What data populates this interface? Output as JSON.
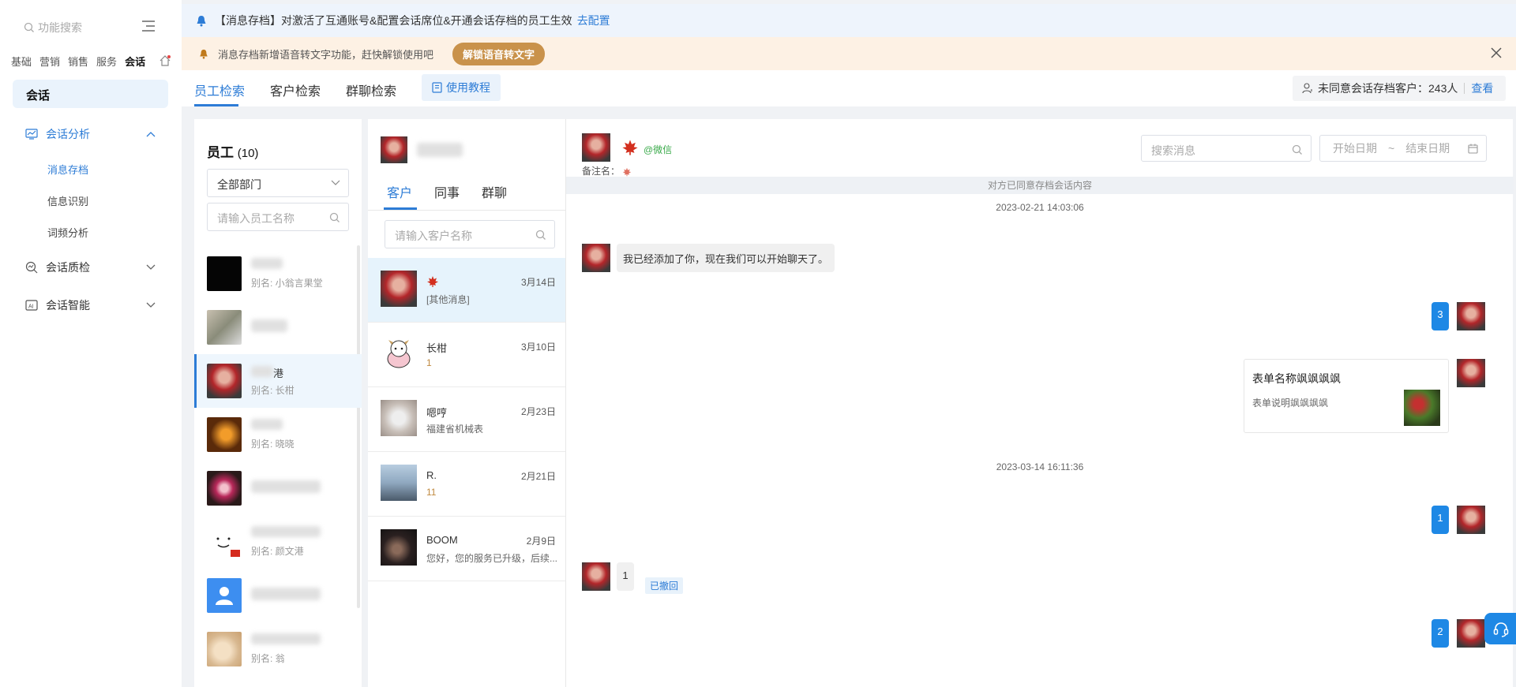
{
  "sidebar": {
    "search_placeholder": "功能搜索",
    "categories": [
      "基础",
      "营销",
      "销售",
      "服务",
      "会话"
    ],
    "active_category": "会话",
    "section_title": "会话",
    "groups": [
      {
        "label": "会话分析",
        "expanded": true,
        "items": [
          "消息存档",
          "信息识别",
          "词频分析"
        ],
        "active_item": "消息存档"
      },
      {
        "label": "会话质检",
        "expanded": false
      },
      {
        "label": "会话智能",
        "expanded": false
      }
    ]
  },
  "notices": {
    "primary_text": "【消息存档】对激活了互通账号&配置会话席位&开通会话存档的员工生效",
    "primary_link": "去配置",
    "secondary_text": "消息存档新增语音转文字功能，赶快解锁使用吧",
    "secondary_button": "解锁语音转文字"
  },
  "tabs": {
    "items": [
      "员工检索",
      "客户检索",
      "群聊检索"
    ],
    "active": "员工检索",
    "tutorial": "使用教程",
    "unagreed_label": "未同意会话存档客户：243人",
    "view_link": "查看"
  },
  "employees": {
    "title": "员工",
    "count": "(10)",
    "department": "全部部门",
    "search_placeholder": "请输入员工名称",
    "list": [
      {
        "name_suffix": "",
        "alias": "别名: 小翁言果堂",
        "avatar": "black"
      },
      {
        "name_suffix": "",
        "alias": "",
        "avatar": "cat"
      },
      {
        "name_suffix": "港",
        "alias": "别名: 长柑",
        "avatar": "red",
        "active": true
      },
      {
        "name_suffix": "",
        "alias": "别名: 晓晓",
        "avatar": "orange"
      },
      {
        "name_suffix": "",
        "alias": "",
        "avatar": "pink"
      },
      {
        "name_suffix": "",
        "alias": "别名: 颜文港",
        "avatar": "smile"
      },
      {
        "name_suffix": "",
        "alias": "",
        "avatar": "blueperson"
      },
      {
        "name_suffix": "",
        "alias": "别名: 翁",
        "avatar": "tan"
      }
    ]
  },
  "customers": {
    "tabs": [
      "客户",
      "同事",
      "群聊"
    ],
    "active_tab": "客户",
    "search_placeholder": "请输入客户名称",
    "list": [
      {
        "name": "",
        "sub": "[其他消息]",
        "date": "3月14日",
        "avatar": "red",
        "active": true
      },
      {
        "name": "长柑",
        "sub": "1",
        "date": "3月10日",
        "avatar": "cartoon"
      },
      {
        "name": "嗯哼",
        "sub": "福建省机械表",
        "date": "2月23日",
        "avatar": "cat"
      },
      {
        "name": "R.",
        "sub": "11",
        "date": "2月21日",
        "avatar": "sea"
      },
      {
        "name": "BOOM",
        "sub": "您好，您的服务已升级，后续...",
        "date": "2月9日",
        "avatar": "dark"
      }
    ]
  },
  "chat": {
    "wechat_tag": "@微信",
    "remark_label": "备注名：",
    "search_placeholder": "搜索消息",
    "start_date": "开始日期",
    "date_sep": "~",
    "end_date": "结束日期",
    "consent_notice": "对方已同意存档会话内容",
    "time1": "2023-02-21 14:03:06",
    "msg_left1": "我已经添加了你，现在我们可以开始聊天了。",
    "msg_right1": "3",
    "card_title": "表单名称飒飒飒飒",
    "card_desc": "表单说明飒飒飒飒",
    "time2": "2023-03-14 16:11:36",
    "msg_right2": "1",
    "msg_left2": "1",
    "recalled": "已撤回",
    "msg_right3": "2"
  },
  "colors": {
    "accent": "#2d7cd6",
    "bubble": "#1e88e5",
    "warning_bg": "#fdf1e4",
    "unlock_btn": "#c9924b"
  }
}
